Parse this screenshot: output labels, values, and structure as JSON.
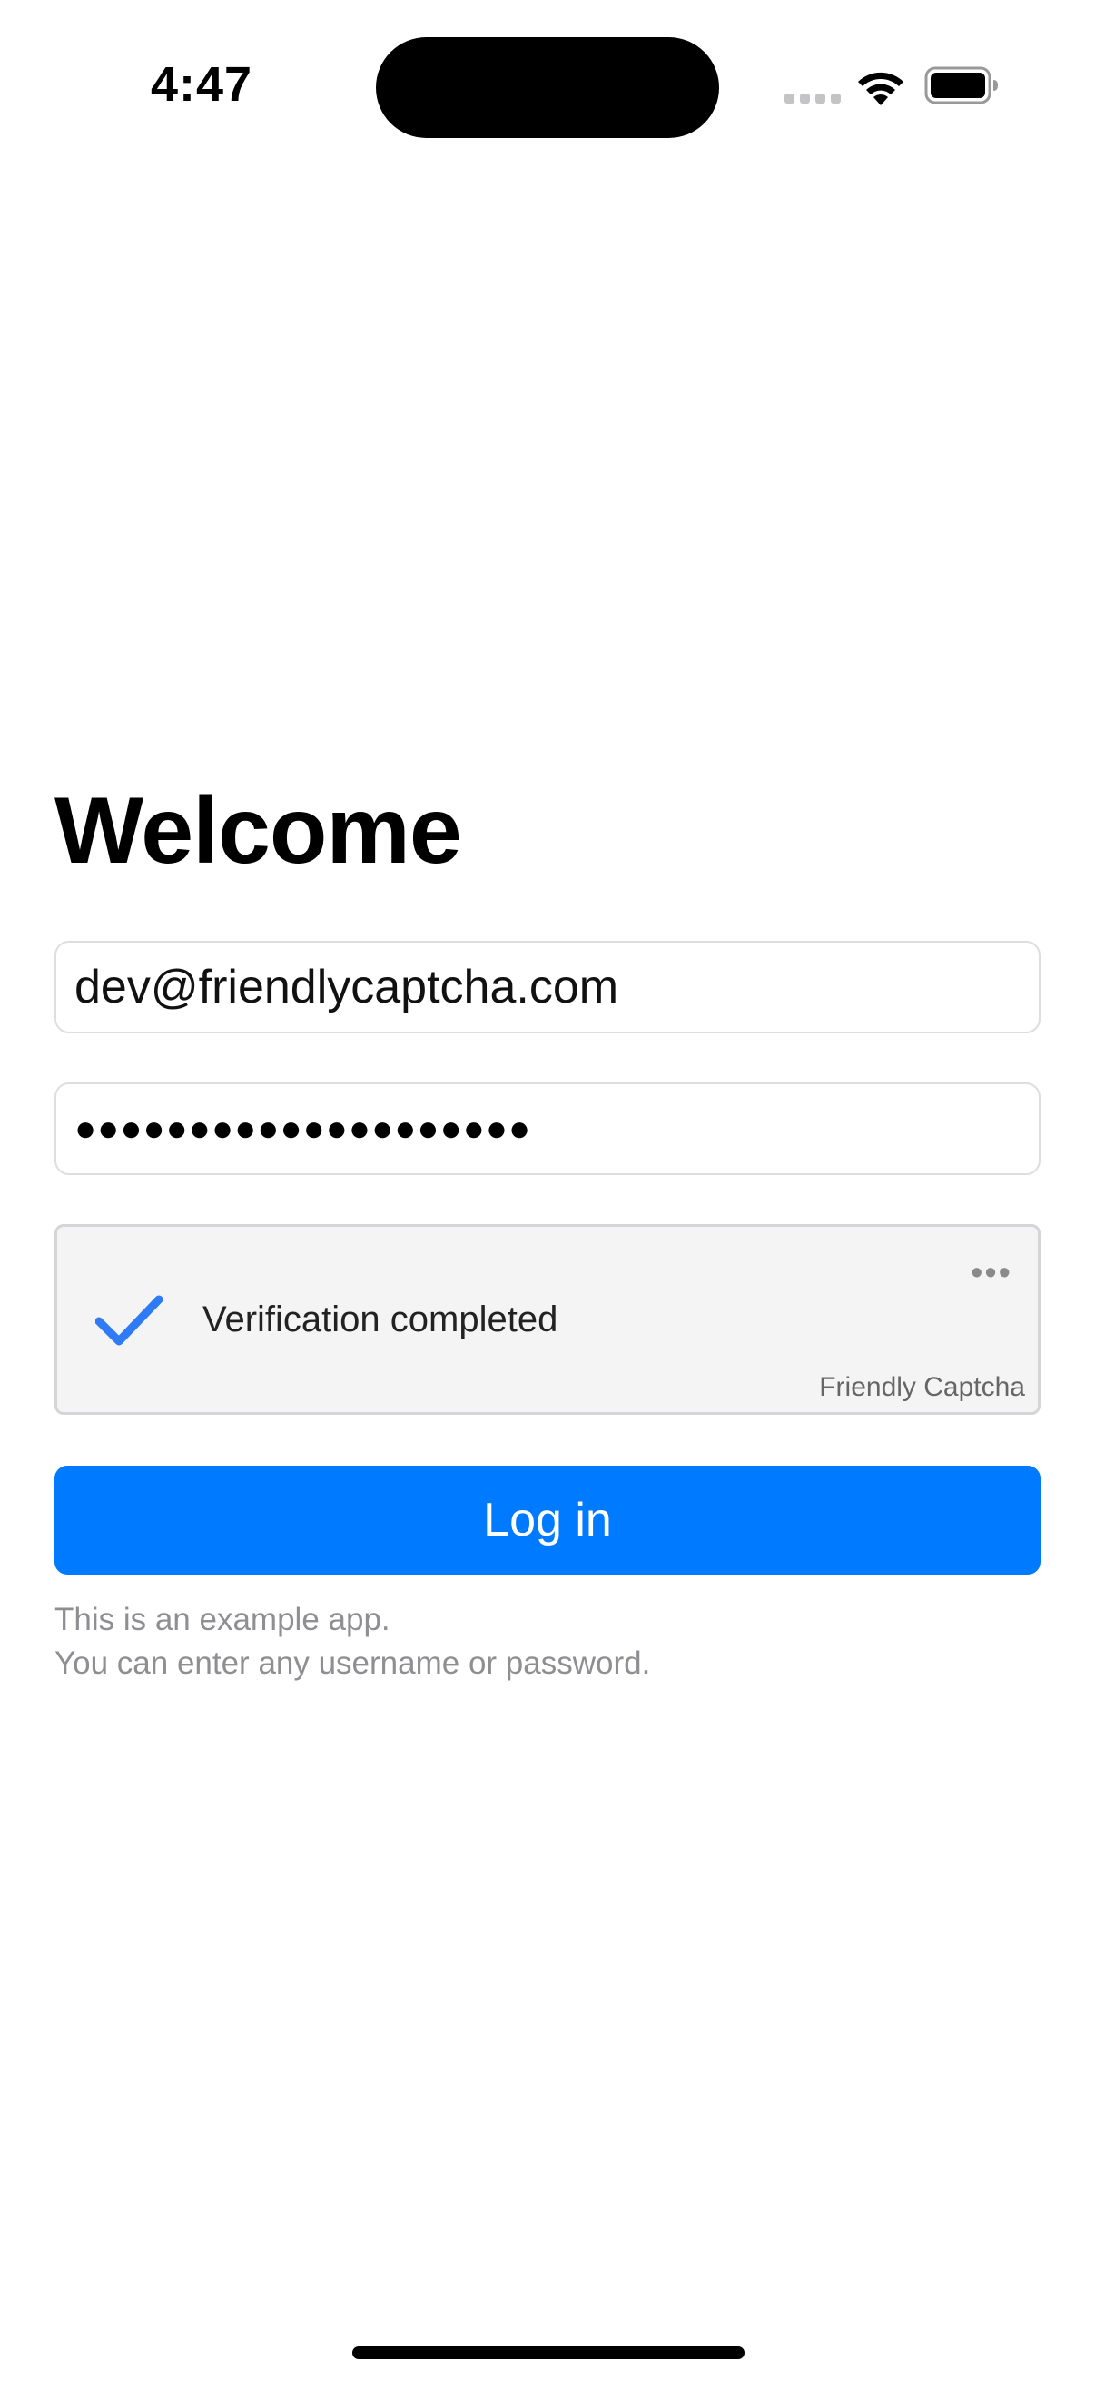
{
  "status_bar": {
    "time": "4:47",
    "signal_icon": "cellular-signal-icon",
    "wifi_icon": "wifi-icon",
    "battery_icon": "battery-icon"
  },
  "login": {
    "title": "Welcome",
    "email_value": "dev@friendlycaptcha.com",
    "password_masked": "●●●●●●●●●●●●●●●●●●●●",
    "button_label": "Log in",
    "note_line1": "This is an example app.",
    "note_line2": "You can enter any username or password."
  },
  "captcha": {
    "status": "Verification completed",
    "brand": "Friendly Captcha",
    "more_label": "•••",
    "check_icon": "checkmark-icon",
    "check_color": "#2f7bf5"
  },
  "colors": {
    "accent": "#007aff",
    "secondary_text": "#8e8e93"
  }
}
